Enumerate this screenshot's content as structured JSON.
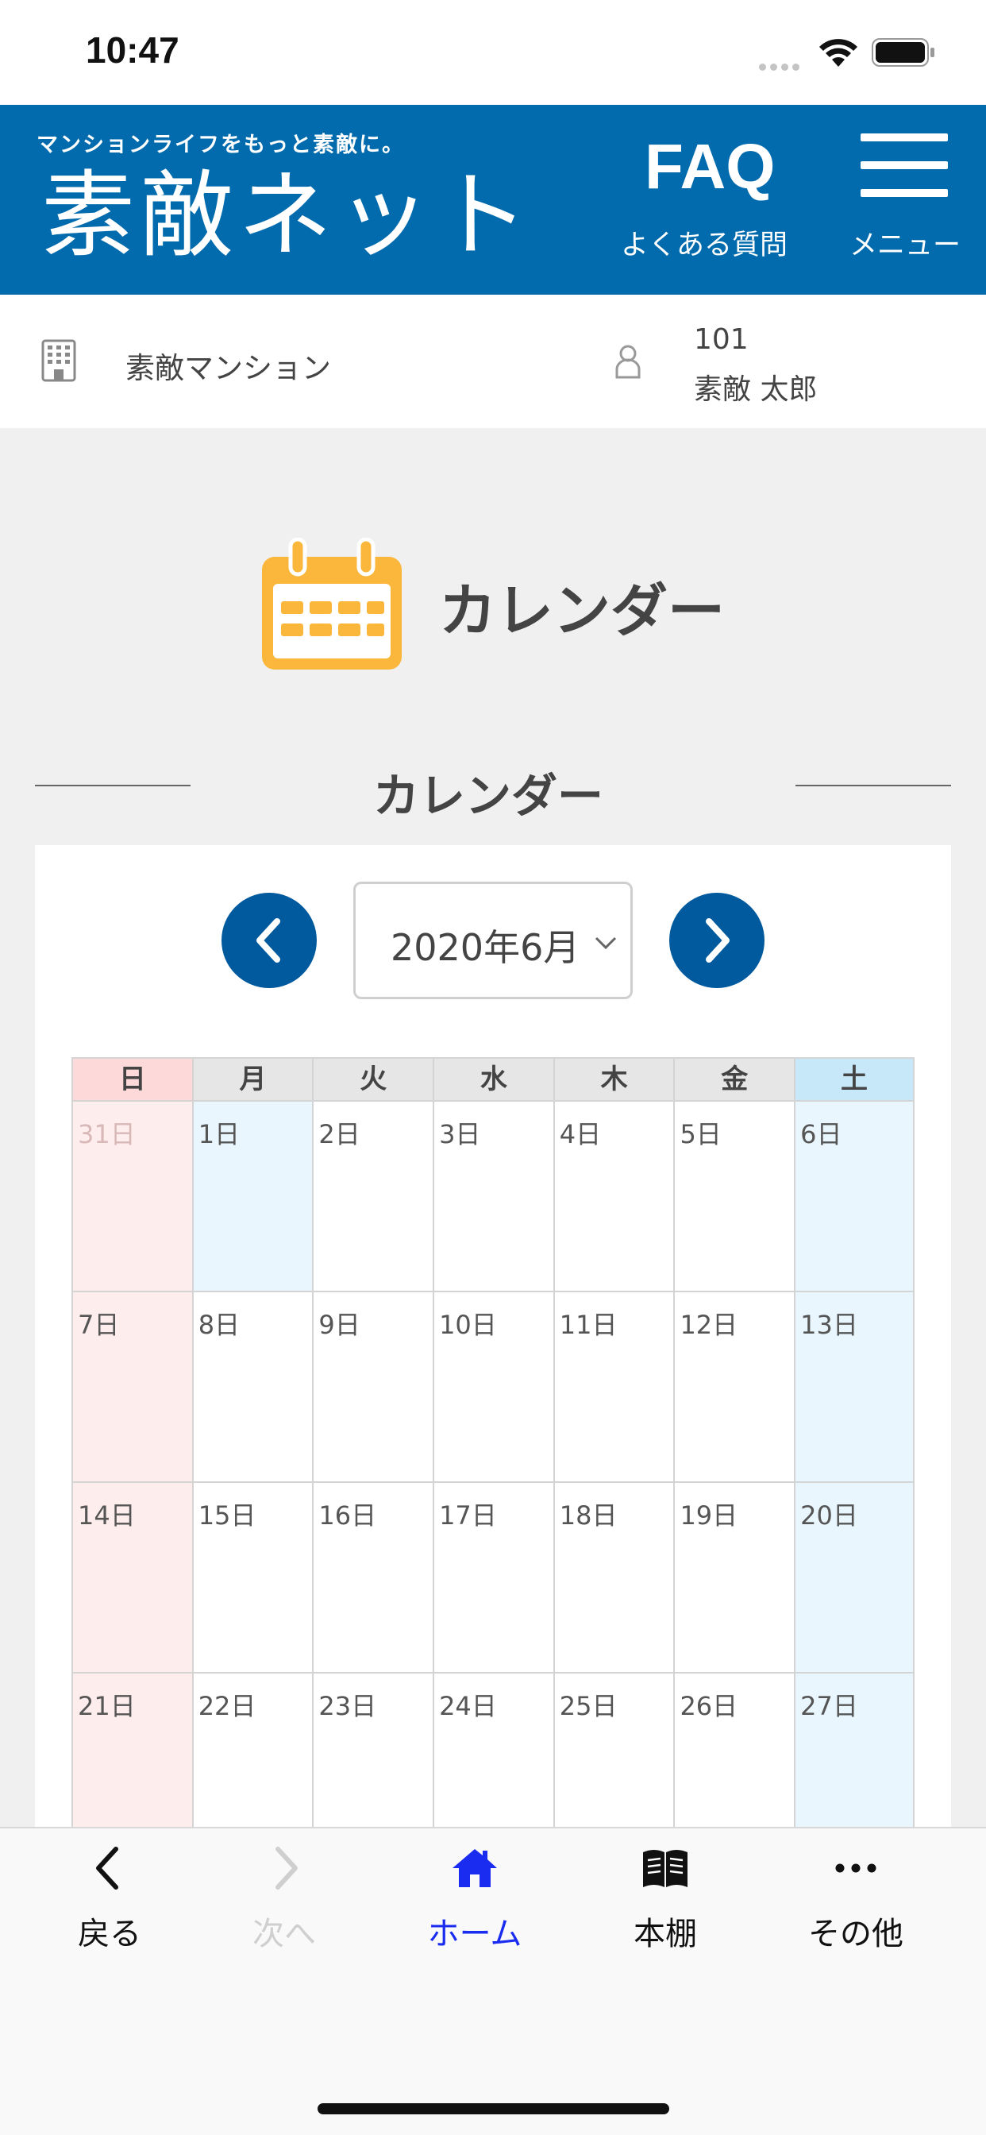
{
  "status_bar": {
    "time": "10:47"
  },
  "header": {
    "tagline": "マンションライフをもっと素敵に。",
    "brand": "素敵ネット",
    "faq_title": "FAQ",
    "faq_subtitle": "よくある質問",
    "menu_label": "メニュー"
  },
  "info_bar": {
    "building_name": "素敵マンション",
    "room_number": "101",
    "resident_name": "素敵 太郎"
  },
  "page": {
    "title": "カレンダー",
    "section_title": "カレンダー"
  },
  "calendar": {
    "month_label": "2020年6月",
    "weekdays": [
      "日",
      "月",
      "火",
      "水",
      "木",
      "金",
      "土"
    ],
    "weeks": [
      [
        "31日",
        "1日",
        "2日",
        "3日",
        "4日",
        "5日",
        "6日"
      ],
      [
        "7日",
        "8日",
        "9日",
        "10日",
        "11日",
        "12日",
        "13日"
      ],
      [
        "14日",
        "15日",
        "16日",
        "17日",
        "18日",
        "19日",
        "20日"
      ],
      [
        "21日",
        "22日",
        "23日",
        "24日",
        "25日",
        "26日",
        "27日"
      ]
    ]
  },
  "toolbar": {
    "back": "戻る",
    "forward": "次へ",
    "home": "ホーム",
    "bookshelf": "本棚",
    "more": "その他"
  },
  "colors": {
    "brand_blue": "#016bad",
    "nav_button": "#015a9e",
    "calendar_icon": "#fbb73c",
    "active_tab": "#1a2cf0"
  }
}
